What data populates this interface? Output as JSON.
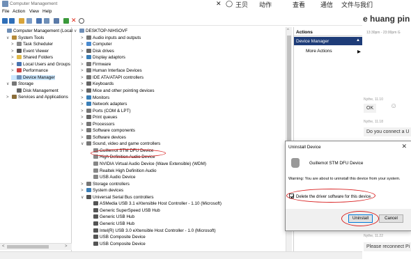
{
  "window_title": "Computer Management",
  "menu": [
    "File",
    "Action",
    "View",
    "Help"
  ],
  "topstrip": [
    "✕",
    "◯",
    "王贝",
    "动作",
    "查看",
    "通信",
    "文件与我们"
  ],
  "left_tree": [
    {
      "label": "Computer Management (Local",
      "indent": 0,
      "arrow": "",
      "color": "#6f8fb7"
    },
    {
      "label": "System Tools",
      "indent": 1,
      "arrow": "∨",
      "color": "#b58a3a"
    },
    {
      "label": "Task Scheduler",
      "indent": 2,
      "arrow": ">",
      "color": "#8a8a8a"
    },
    {
      "label": "Event Viewer",
      "indent": 2,
      "arrow": ">",
      "color": "#555"
    },
    {
      "label": "Shared Folders",
      "indent": 2,
      "arrow": ">",
      "color": "#e0b94a"
    },
    {
      "label": "Local Users and Groups",
      "indent": 2,
      "arrow": ">",
      "color": "#4a74b0"
    },
    {
      "label": "Performance",
      "indent": 2,
      "arrow": ">",
      "color": "#c44"
    },
    {
      "label": "Device Manager",
      "indent": 2,
      "arrow": "",
      "color": "#6f8fb7",
      "selected": true
    },
    {
      "label": "Storage",
      "indent": 1,
      "arrow": "∨",
      "color": "#777"
    },
    {
      "label": "Disk Management",
      "indent": 2,
      "arrow": "",
      "color": "#666"
    },
    {
      "label": "Services and Applications",
      "indent": 1,
      "arrow": ">",
      "color": "#8a6e3a"
    }
  ],
  "device_tree": [
    {
      "label": "DESKTOP-NIHSOVF",
      "indent": 0,
      "arrow": "∨",
      "color": "#6f8fb7"
    },
    {
      "label": "Audio inputs and outputs",
      "indent": 1,
      "arrow": ">",
      "color": "#777"
    },
    {
      "label": "Computer",
      "indent": 1,
      "arrow": ">",
      "color": "#4a8bd0"
    },
    {
      "label": "Disk drives",
      "indent": 1,
      "arrow": ">",
      "color": "#666"
    },
    {
      "label": "Display adaptors",
      "indent": 1,
      "arrow": ">",
      "color": "#3a7fb8"
    },
    {
      "label": "Firmware",
      "indent": 1,
      "arrow": ">",
      "color": "#777"
    },
    {
      "label": "Human Interface Devices",
      "indent": 1,
      "arrow": ">",
      "color": "#777"
    },
    {
      "label": "IDE ATA/ATAPI controllers",
      "indent": 1,
      "arrow": ">",
      "color": "#777"
    },
    {
      "label": "Keyboards",
      "indent": 1,
      "arrow": ">",
      "color": "#666"
    },
    {
      "label": "Mice and other pointing devices",
      "indent": 1,
      "arrow": ">",
      "color": "#666"
    },
    {
      "label": "Monitors",
      "indent": 1,
      "arrow": ">",
      "color": "#3a7fb8"
    },
    {
      "label": "Network adapters",
      "indent": 1,
      "arrow": ">",
      "color": "#3a7fb8"
    },
    {
      "label": "Ports (COM & LPT)",
      "indent": 1,
      "arrow": ">",
      "color": "#777"
    },
    {
      "label": "Print queues",
      "indent": 1,
      "arrow": ">",
      "color": "#666"
    },
    {
      "label": "Processors",
      "indent": 1,
      "arrow": ">",
      "color": "#777"
    },
    {
      "label": "Software components",
      "indent": 1,
      "arrow": ">",
      "color": "#777"
    },
    {
      "label": "Software devices",
      "indent": 1,
      "arrow": ">",
      "color": "#777"
    },
    {
      "label": "Sound, video and game controllers",
      "indent": 1,
      "arrow": "∨",
      "color": "#777"
    },
    {
      "label": "Guillemot STM DFU Device",
      "indent": 2,
      "arrow": "",
      "color": "#888"
    },
    {
      "label": "High Definition Audio Device",
      "indent": 2,
      "arrow": "",
      "color": "#888"
    },
    {
      "label": "NVIDIA Virtual Audio Device (Wave Extensible) (WDM)",
      "indent": 2,
      "arrow": "",
      "color": "#888"
    },
    {
      "label": "Realtek High Definition Audio",
      "indent": 2,
      "arrow": "",
      "color": "#888"
    },
    {
      "label": "USB Audio Device",
      "indent": 2,
      "arrow": "",
      "color": "#888"
    },
    {
      "label": "Storage controllers",
      "indent": 1,
      "arrow": ">",
      "color": "#777"
    },
    {
      "label": "System devices",
      "indent": 1,
      "arrow": ">",
      "color": "#3a7fb8"
    },
    {
      "label": "Universal Serial Bus controllers",
      "indent": 1,
      "arrow": "∨",
      "color": "#555"
    },
    {
      "label": "ASMedia USB 3.1 eXtensible Host Controller - 1.10 (Microsoft)",
      "indent": 2,
      "arrow": "",
      "color": "#555"
    },
    {
      "label": "Generic SuperSpeed USB Hub",
      "indent": 2,
      "arrow": "",
      "color": "#555"
    },
    {
      "label": "Generic USB Hub",
      "indent": 2,
      "arrow": "",
      "color": "#555"
    },
    {
      "label": "Generic USB Hub",
      "indent": 2,
      "arrow": "",
      "color": "#555"
    },
    {
      "label": "Intel(R) USB 3.0 eXtensible Host Controller - 1.0 (Microsoft)",
      "indent": 2,
      "arrow": "",
      "color": "#555"
    },
    {
      "label": "USB Composite Device",
      "indent": 2,
      "arrow": "",
      "color": "#555"
    },
    {
      "label": "USB Composite Device",
      "indent": 2,
      "arrow": "",
      "color": "#555"
    }
  ],
  "actions": {
    "header": "Actions",
    "section": "Device Manager",
    "more": "More Actions"
  },
  "chat": {
    "title": "e huang pin",
    "time": "13:30pm - 23:00pm G",
    "messages": [
      {
        "meta": "Nythe, 11.10",
        "text": "OK"
      },
      {
        "meta": "Nythe, 11.18",
        "text": "Do you connect a U"
      },
      {
        "meta": "Nythe, 11.22",
        "text": "Please reconnect Pi"
      }
    ]
  },
  "dialog": {
    "title": "Uninstall Device",
    "device": "Guillemot STM DFU Device",
    "warning": "Warning: You are about to uninstall this device from your system.",
    "checkbox_label": "Delete the driver software for this device.",
    "checked": true,
    "uninstall": "Uninstall",
    "cancel": "Cancel"
  }
}
